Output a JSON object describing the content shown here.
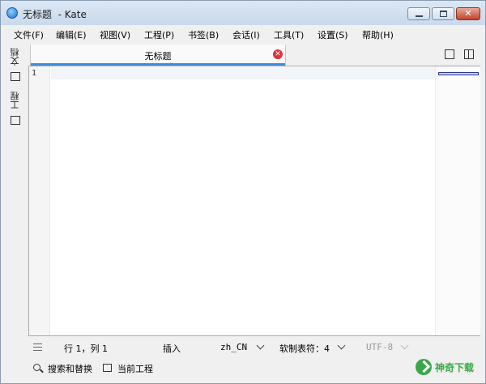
{
  "window": {
    "title": "无标题  - Kate"
  },
  "menu": [
    {
      "id": "file",
      "label": "文件(F)"
    },
    {
      "id": "edit",
      "label": "编辑(E)"
    },
    {
      "id": "view",
      "label": "视图(V)"
    },
    {
      "id": "project",
      "label": "工程(P)"
    },
    {
      "id": "bookmarks",
      "label": "书签(B)"
    },
    {
      "id": "sessions",
      "label": "会话(I)"
    },
    {
      "id": "tools",
      "label": "工具(T)"
    },
    {
      "id": "settings",
      "label": "设置(S)"
    },
    {
      "id": "help",
      "label": "帮助(H)"
    }
  ],
  "sidebar": {
    "documents_label": "文档",
    "projects_label": "工程"
  },
  "tab": {
    "label": "无标题"
  },
  "editor": {
    "line_number": "1"
  },
  "status": {
    "position": "行 1，列 1",
    "mode": "插入",
    "dictionary": "zh_CN",
    "indent": "软制表符：4",
    "encoding": "UTF-8"
  },
  "bottom": {
    "search_replace": "搜索和替换",
    "current_project": "当前工程"
  },
  "watermark": {
    "text": "神奇下载"
  },
  "colors": {
    "tab_accent": "#3c8de0",
    "close_red": "#e0323a",
    "watermark_green": "#3aa84a"
  }
}
